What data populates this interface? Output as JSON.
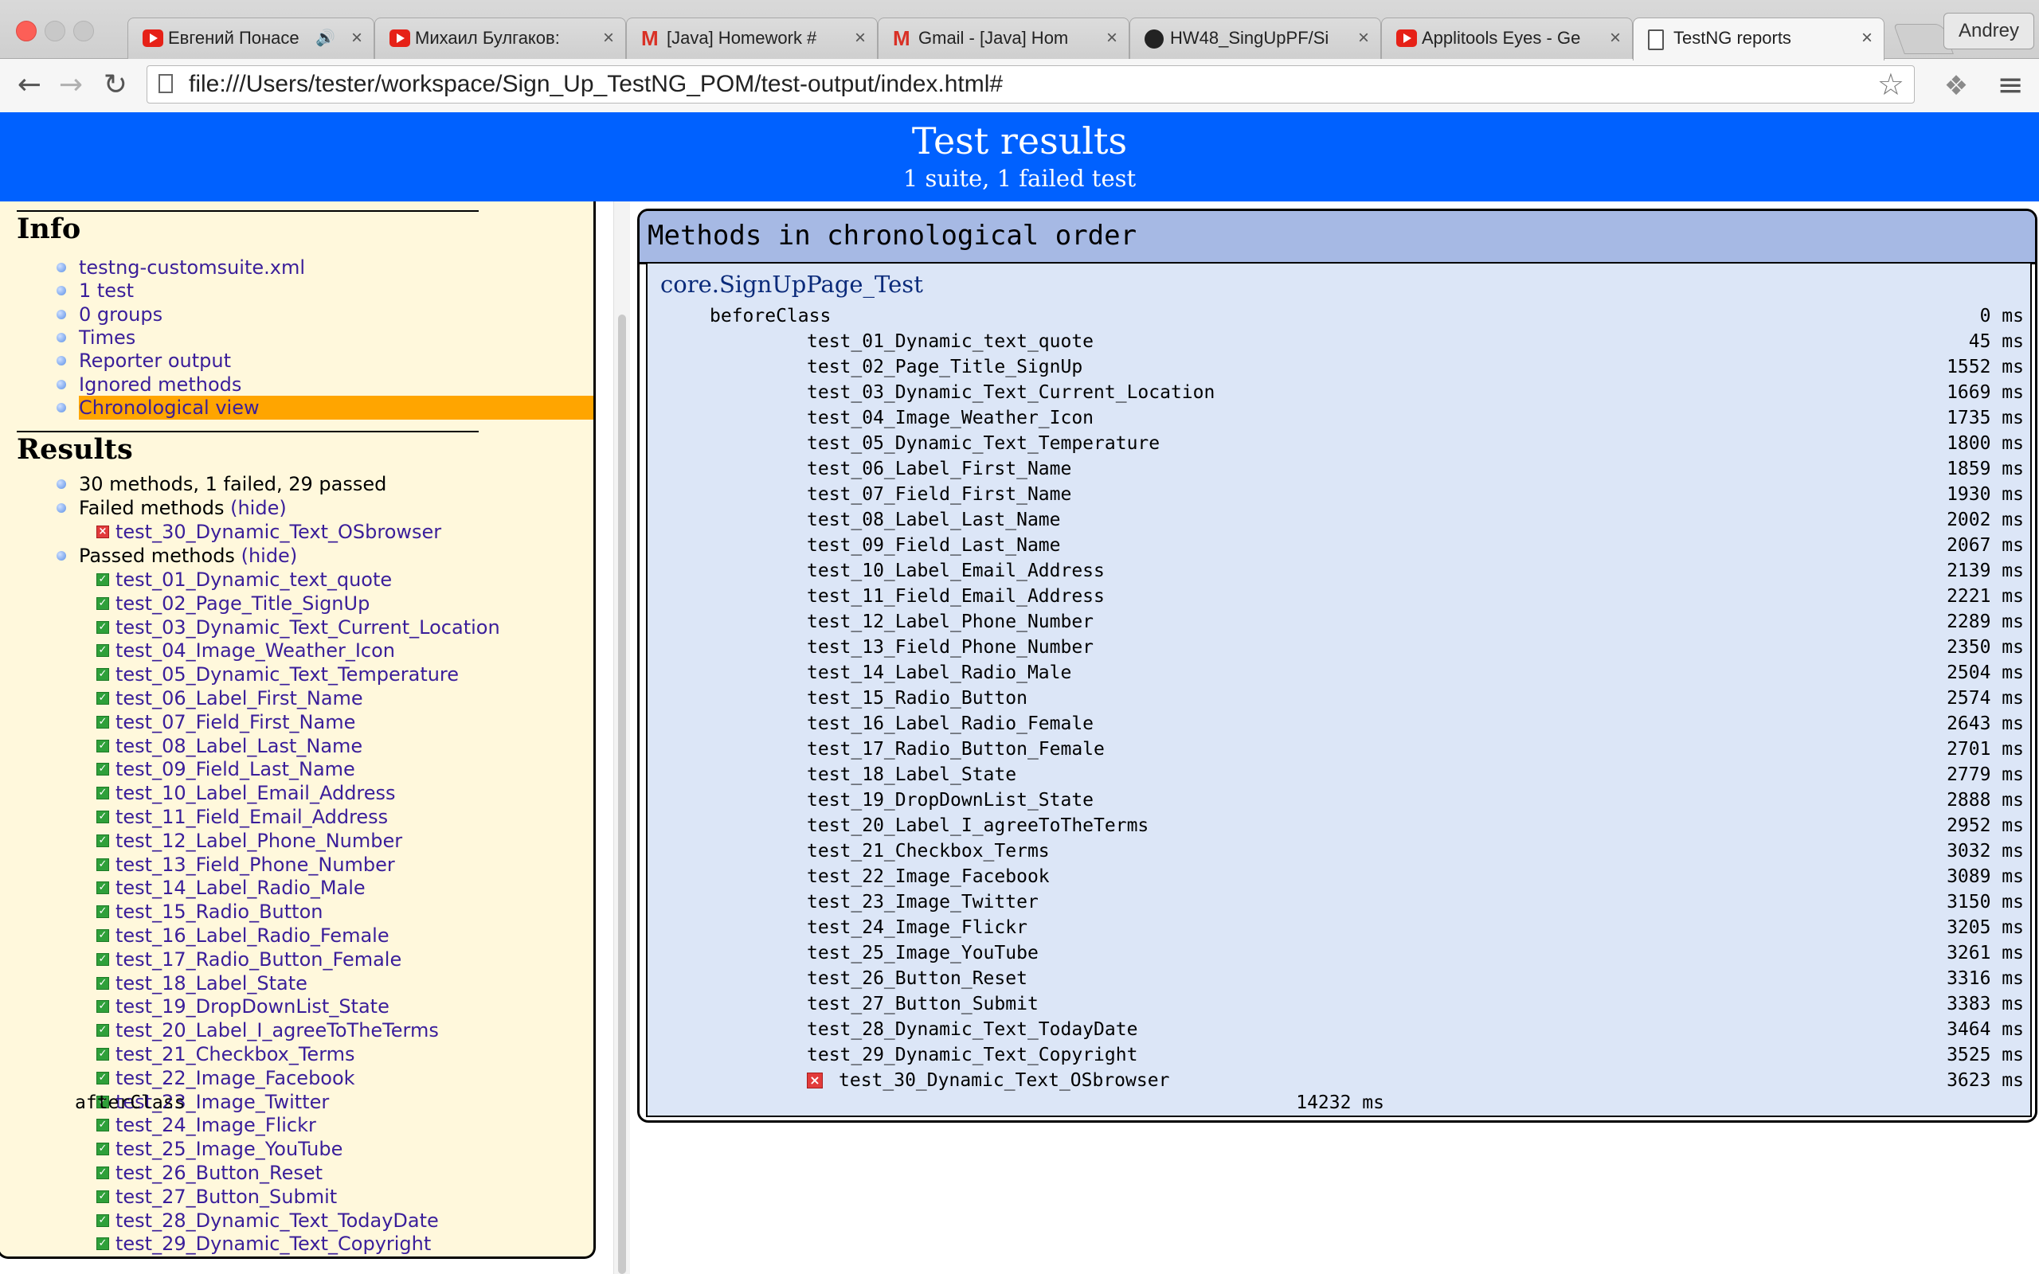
{
  "browser": {
    "tabs": [
      {
        "label": "Евгений Понасе",
        "icon": "youtube-icon",
        "audio": true
      },
      {
        "label": "Михаил Булгаков: ",
        "icon": "youtube-icon",
        "audio": false
      },
      {
        "label": "[Java] Homework #",
        "icon": "gmail-icon",
        "audio": false
      },
      {
        "label": "Gmail - [Java] Hom",
        "icon": "gmail-icon",
        "audio": false
      },
      {
        "label": "HW48_SingUpPF/Si",
        "icon": "github-icon",
        "audio": false
      },
      {
        "label": "Applitools Eyes - Ge",
        "icon": "youtube-icon",
        "audio": false
      },
      {
        "label": "TestNG reports",
        "icon": "document-icon",
        "audio": false,
        "active": true
      }
    ],
    "profile_name": "Andrey",
    "url": "file:///Users/tester/workspace/Sign_Up_TestNG_POM/test-output/index.html#"
  },
  "banner": {
    "title": "Test results",
    "subtitle": "1 suite, 1 failed test"
  },
  "info": {
    "heading": "Info",
    "items": [
      "testng-customsuite.xml",
      "1 test",
      "0 groups",
      "Times",
      "Reporter output",
      "Ignored methods",
      "Chronological view"
    ],
    "selected": "Chronological view"
  },
  "results": {
    "heading": "Results",
    "summary": "30 methods, 1 failed, 29 passed",
    "failed_label": "Failed methods",
    "passed_label": "Passed methods",
    "hide_label": "(hide)",
    "failed_methods": [
      "test_30_Dynamic_Text_OSbrowser"
    ],
    "passed_methods": [
      "test_01_Dynamic_text_quote",
      "test_02_Page_Title_SignUp",
      "test_03_Dynamic_Text_Current_Location",
      "test_04_Image_Weather_Icon",
      "test_05_Dynamic_Text_Temperature",
      "test_06_Label_First_Name",
      "test_07_Field_First_Name",
      "test_08_Label_Last_Name",
      "test_09_Field_Last_Name",
      "test_10_Label_Email_Address",
      "test_11_Field_Email_Address",
      "test_12_Label_Phone_Number",
      "test_13_Field_Phone_Number",
      "test_14_Label_Radio_Male",
      "test_15_Radio_Button",
      "test_16_Label_Radio_Female",
      "test_17_Radio_Button_Female",
      "test_18_Label_State",
      "test_19_DropDownList_State",
      "test_20_Label_I_agreeToTheTerms",
      "test_21_Checkbox_Terms",
      "test_22_Image_Facebook",
      "test_23_Image_Twitter",
      "test_24_Image_Flickr",
      "test_25_Image_YouTube",
      "test_26_Button_Reset",
      "test_27_Button_Submit",
      "test_28_Dynamic_Text_TodayDate",
      "test_29_Dynamic_Text_Copyright"
    ]
  },
  "chronological": {
    "heading": "Methods in chronological order",
    "class_name": "core.SignUpPage_Test",
    "before": {
      "name": "beforeClass",
      "time": "0 ms"
    },
    "methods": [
      {
        "name": "test_01_Dynamic_text_quote",
        "time": "45 ms",
        "failed": false
      },
      {
        "name": "test_02_Page_Title_SignUp",
        "time": "1552 ms",
        "failed": false
      },
      {
        "name": "test_03_Dynamic_Text_Current_Location",
        "time": "1669 ms",
        "failed": false
      },
      {
        "name": "test_04_Image_Weather_Icon",
        "time": "1735 ms",
        "failed": false
      },
      {
        "name": "test_05_Dynamic_Text_Temperature",
        "time": "1800 ms",
        "failed": false
      },
      {
        "name": "test_06_Label_First_Name",
        "time": "1859 ms",
        "failed": false
      },
      {
        "name": "test_07_Field_First_Name",
        "time": "1930 ms",
        "failed": false
      },
      {
        "name": "test_08_Label_Last_Name",
        "time": "2002 ms",
        "failed": false
      },
      {
        "name": "test_09_Field_Last_Name",
        "time": "2067 ms",
        "failed": false
      },
      {
        "name": "test_10_Label_Email_Address",
        "time": "2139 ms",
        "failed": false
      },
      {
        "name": "test_11_Field_Email_Address",
        "time": "2221 ms",
        "failed": false
      },
      {
        "name": "test_12_Label_Phone_Number",
        "time": "2289 ms",
        "failed": false
      },
      {
        "name": "test_13_Field_Phone_Number",
        "time": "2350 ms",
        "failed": false
      },
      {
        "name": "test_14_Label_Radio_Male",
        "time": "2504 ms",
        "failed": false
      },
      {
        "name": "test_15_Radio_Button",
        "time": "2574 ms",
        "failed": false
      },
      {
        "name": "test_16_Label_Radio_Female",
        "time": "2643 ms",
        "failed": false
      },
      {
        "name": "test_17_Radio_Button_Female",
        "time": "2701 ms",
        "failed": false
      },
      {
        "name": "test_18_Label_State",
        "time": "2779 ms",
        "failed": false
      },
      {
        "name": "test_19_DropDownList_State",
        "time": "2888 ms",
        "failed": false
      },
      {
        "name": "test_20_Label_I_agreeToTheTerms",
        "time": "2952 ms",
        "failed": false
      },
      {
        "name": "test_21_Checkbox_Terms",
        "time": "3032 ms",
        "failed": false
      },
      {
        "name": "test_22_Image_Facebook",
        "time": "3089 ms",
        "failed": false
      },
      {
        "name": "test_23_Image_Twitter",
        "time": "3150 ms",
        "failed": false
      },
      {
        "name": "test_24_Image_Flickr",
        "time": "3205 ms",
        "failed": false
      },
      {
        "name": "test_25_Image_YouTube",
        "time": "3261 ms",
        "failed": false
      },
      {
        "name": "test_26_Button_Reset",
        "time": "3316 ms",
        "failed": false
      },
      {
        "name": "test_27_Button_Submit",
        "time": "3383 ms",
        "failed": false
      },
      {
        "name": "test_28_Dynamic_Text_TodayDate",
        "time": "3464 ms",
        "failed": false
      },
      {
        "name": "test_29_Dynamic_Text_Copyright",
        "time": "3525 ms",
        "failed": false
      },
      {
        "name": "test_30_Dynamic_Text_OSbrowser",
        "time": "3623 ms",
        "failed": true
      }
    ],
    "after": {
      "name": "afterClass",
      "time": "14232 ms"
    }
  },
  "colors": {
    "banner": "#0061ff",
    "panel_bg": "#fff8dc",
    "selected": "#ffa500",
    "header_bg": "#a6b9e4",
    "content_bg": "#dce6f7",
    "link": "#3a1e9a"
  }
}
